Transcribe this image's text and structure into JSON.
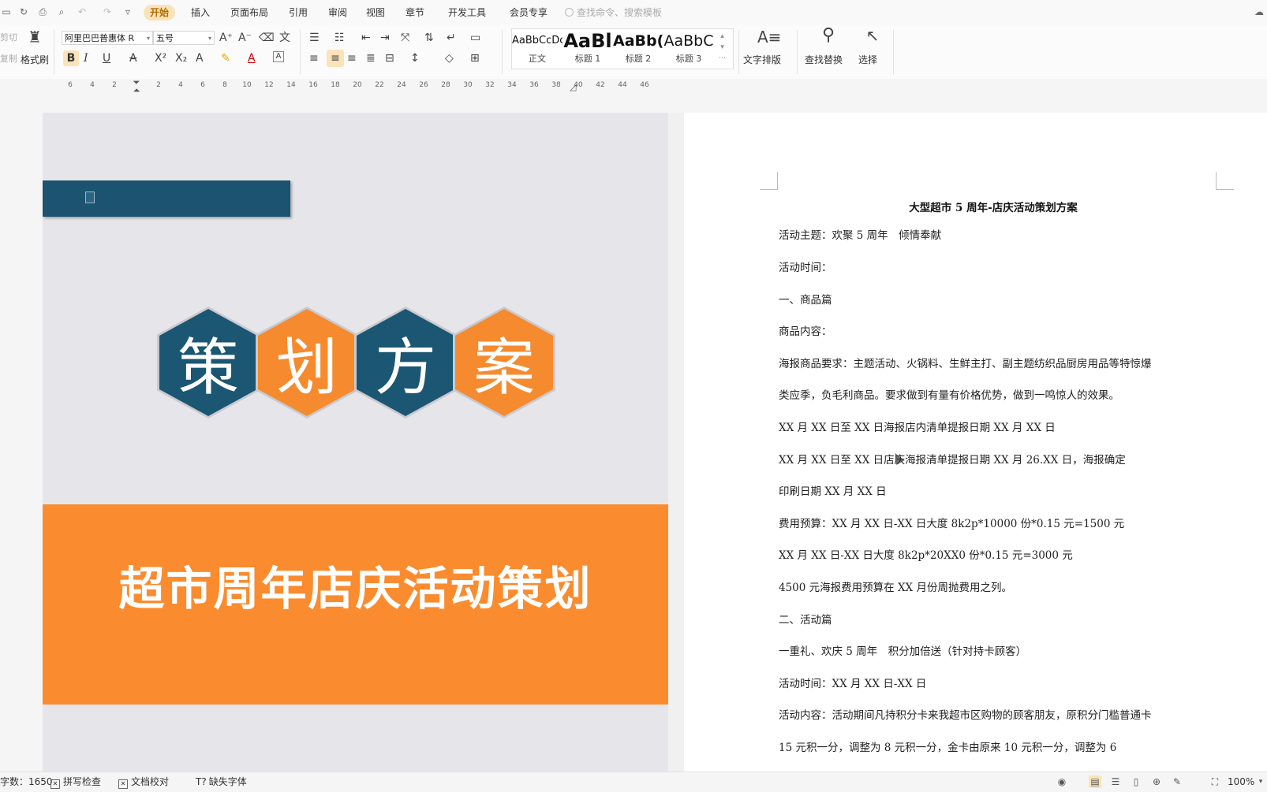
{
  "menubar": {
    "tabs": [
      "开始",
      "插入",
      "页面布局",
      "引用",
      "审阅",
      "视图",
      "章节",
      "开发工具",
      "会员专享"
    ],
    "active_tab": "开始",
    "search_placeholder": "查找命令、搜索模板"
  },
  "ribbon": {
    "cut_label": "剪切",
    "copy_label": "复制",
    "format_painter_label": "格式刷",
    "font_name": "阿里巴巴普惠体 R",
    "font_size": "五号",
    "styles": [
      {
        "preview": "AaBbCcDc",
        "name": "正文"
      },
      {
        "preview": "AaBl",
        "name": "标题 1"
      },
      {
        "preview": "AaBb(",
        "name": "标题 2"
      },
      {
        "preview": "AaBbC",
        "name": "标题 3"
      }
    ],
    "text_layout_label": "文字排版",
    "find_replace_label": "查找替换",
    "select_label": "选择"
  },
  "ruler": {
    "ticks": [
      "6",
      "4",
      "2",
      "2",
      "4",
      "6",
      "8",
      "10",
      "12",
      "14",
      "16",
      "18",
      "20",
      "22",
      "24",
      "26",
      "28",
      "30",
      "32",
      "34",
      "36",
      "38",
      "40",
      "42",
      "44",
      "46"
    ]
  },
  "slide": {
    "hex_chars": [
      "策",
      "划",
      "方",
      "案"
    ],
    "title": "超市周年店庆活动策划",
    "colors": {
      "blue": "#1b5672",
      "orange": "#fa8c2f"
    }
  },
  "doc": {
    "title": "大型超市 5 周年-店庆活动策划方案",
    "lines": [
      "活动主题：欢聚 5 周年　倾情奉献",
      "活动时间：",
      "一、商品篇",
      "商品内容：",
      "海报商品要求：主题活动、火锅料、生鲜主打、副主题纺织品厨房用品等特惊爆",
      "类应季，负毛利商品。要求做到有量有价格优势，做到一鸣惊人的效果。",
      "XX 月 XX 日至 XX 日海报店内清单提报日期 XX 月 XX 日",
      "XX 月 XX 日至 XX 日店庆海报清单提报日期 XX 月 26.XX 日，海报确定",
      "印刷日期 XX 月 XX 日",
      "费用预算：XX 月 XX 日-XX 日大度 8k2p*10000 份*0.15 元=1500 元",
      "XX 月 XX 日-XX 日大度 8k2p*20XX0 份*0.15 元=3000 元",
      "4500 元海报费用预算在 XX 月份周抛费用之列。",
      "二、活动篇",
      "一重礼、欢庆 5 周年　积分加倍送（针对持卡顾客）",
      "活动时间：XX 月 XX 日-XX 日",
      "活动内容：活动期间凡持积分卡来我超市区购物的顾客朋友，原积分门槛普通卡",
      "15 元积一分，调整为 8 元积一分，金卡由原来 10 元积一分，调整为 6"
    ]
  },
  "statusbar": {
    "word_count": "字数：1650",
    "spell_check": "拼写检查",
    "doc_proof": "文档校对",
    "missing_font": "缺失字体",
    "zoom": "100%"
  }
}
